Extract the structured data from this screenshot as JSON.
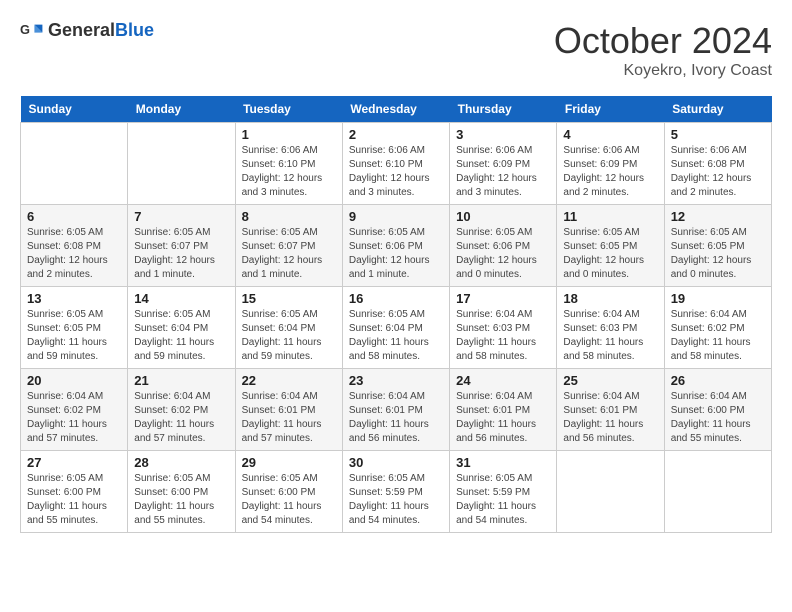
{
  "header": {
    "logo": {
      "general": "General",
      "blue": "Blue"
    },
    "month": "October 2024",
    "location": "Koyekro, Ivory Coast"
  },
  "weekdays": [
    "Sunday",
    "Monday",
    "Tuesday",
    "Wednesday",
    "Thursday",
    "Friday",
    "Saturday"
  ],
  "weeks": [
    [
      null,
      null,
      {
        "day": "1",
        "sunrise": "6:06 AM",
        "sunset": "6:10 PM",
        "daylight": "12 hours and 3 minutes."
      },
      {
        "day": "2",
        "sunrise": "6:06 AM",
        "sunset": "6:10 PM",
        "daylight": "12 hours and 3 minutes."
      },
      {
        "day": "3",
        "sunrise": "6:06 AM",
        "sunset": "6:09 PM",
        "daylight": "12 hours and 3 minutes."
      },
      {
        "day": "4",
        "sunrise": "6:06 AM",
        "sunset": "6:09 PM",
        "daylight": "12 hours and 2 minutes."
      },
      {
        "day": "5",
        "sunrise": "6:06 AM",
        "sunset": "6:08 PM",
        "daylight": "12 hours and 2 minutes."
      }
    ],
    [
      {
        "day": "6",
        "sunrise": "6:05 AM",
        "sunset": "6:08 PM",
        "daylight": "12 hours and 2 minutes."
      },
      {
        "day": "7",
        "sunrise": "6:05 AM",
        "sunset": "6:07 PM",
        "daylight": "12 hours and 1 minute."
      },
      {
        "day": "8",
        "sunrise": "6:05 AM",
        "sunset": "6:07 PM",
        "daylight": "12 hours and 1 minute."
      },
      {
        "day": "9",
        "sunrise": "6:05 AM",
        "sunset": "6:06 PM",
        "daylight": "12 hours and 1 minute."
      },
      {
        "day": "10",
        "sunrise": "6:05 AM",
        "sunset": "6:06 PM",
        "daylight": "12 hours and 0 minutes."
      },
      {
        "day": "11",
        "sunrise": "6:05 AM",
        "sunset": "6:05 PM",
        "daylight": "12 hours and 0 minutes."
      },
      {
        "day": "12",
        "sunrise": "6:05 AM",
        "sunset": "6:05 PM",
        "daylight": "12 hours and 0 minutes."
      }
    ],
    [
      {
        "day": "13",
        "sunrise": "6:05 AM",
        "sunset": "6:05 PM",
        "daylight": "11 hours and 59 minutes."
      },
      {
        "day": "14",
        "sunrise": "6:05 AM",
        "sunset": "6:04 PM",
        "daylight": "11 hours and 59 minutes."
      },
      {
        "day": "15",
        "sunrise": "6:05 AM",
        "sunset": "6:04 PM",
        "daylight": "11 hours and 59 minutes."
      },
      {
        "day": "16",
        "sunrise": "6:05 AM",
        "sunset": "6:04 PM",
        "daylight": "11 hours and 58 minutes."
      },
      {
        "day": "17",
        "sunrise": "6:04 AM",
        "sunset": "6:03 PM",
        "daylight": "11 hours and 58 minutes."
      },
      {
        "day": "18",
        "sunrise": "6:04 AM",
        "sunset": "6:03 PM",
        "daylight": "11 hours and 58 minutes."
      },
      {
        "day": "19",
        "sunrise": "6:04 AM",
        "sunset": "6:02 PM",
        "daylight": "11 hours and 58 minutes."
      }
    ],
    [
      {
        "day": "20",
        "sunrise": "6:04 AM",
        "sunset": "6:02 PM",
        "daylight": "11 hours and 57 minutes."
      },
      {
        "day": "21",
        "sunrise": "6:04 AM",
        "sunset": "6:02 PM",
        "daylight": "11 hours and 57 minutes."
      },
      {
        "day": "22",
        "sunrise": "6:04 AM",
        "sunset": "6:01 PM",
        "daylight": "11 hours and 57 minutes."
      },
      {
        "day": "23",
        "sunrise": "6:04 AM",
        "sunset": "6:01 PM",
        "daylight": "11 hours and 56 minutes."
      },
      {
        "day": "24",
        "sunrise": "6:04 AM",
        "sunset": "6:01 PM",
        "daylight": "11 hours and 56 minutes."
      },
      {
        "day": "25",
        "sunrise": "6:04 AM",
        "sunset": "6:01 PM",
        "daylight": "11 hours and 56 minutes."
      },
      {
        "day": "26",
        "sunrise": "6:04 AM",
        "sunset": "6:00 PM",
        "daylight": "11 hours and 55 minutes."
      }
    ],
    [
      {
        "day": "27",
        "sunrise": "6:05 AM",
        "sunset": "6:00 PM",
        "daylight": "11 hours and 55 minutes."
      },
      {
        "day": "28",
        "sunrise": "6:05 AM",
        "sunset": "6:00 PM",
        "daylight": "11 hours and 55 minutes."
      },
      {
        "day": "29",
        "sunrise": "6:05 AM",
        "sunset": "6:00 PM",
        "daylight": "11 hours and 54 minutes."
      },
      {
        "day": "30",
        "sunrise": "6:05 AM",
        "sunset": "5:59 PM",
        "daylight": "11 hours and 54 minutes."
      },
      {
        "day": "31",
        "sunrise": "6:05 AM",
        "sunset": "5:59 PM",
        "daylight": "11 hours and 54 minutes."
      },
      null,
      null
    ]
  ],
  "labels": {
    "sunrise": "Sunrise: ",
    "sunset": "Sunset: ",
    "daylight": "Daylight: "
  }
}
